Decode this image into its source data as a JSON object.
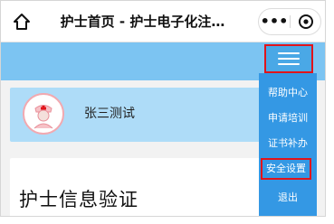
{
  "topbar": {
    "home_icon": "home-icon",
    "title": "护士首页 - 护士电子化注…",
    "more_icon": "more-dots-icon",
    "more_text": "•••",
    "target_icon": "target-icon"
  },
  "navbar": {
    "menu_icon": "hamburger-menu-icon",
    "color": "#7cc4f2"
  },
  "profile": {
    "avatar_icon": "nurse-avatar-icon",
    "name": "张三测试"
  },
  "verify": {
    "title": "护士信息验证"
  },
  "menu": {
    "items": [
      {
        "label": "帮助中心"
      },
      {
        "label": "申请培训"
      },
      {
        "label": "证书补办"
      },
      {
        "label": "安全设置",
        "highlighted": true
      },
      {
        "label": "退出"
      }
    ],
    "color": "#3498e4",
    "highlight_color": "#e1141b"
  }
}
